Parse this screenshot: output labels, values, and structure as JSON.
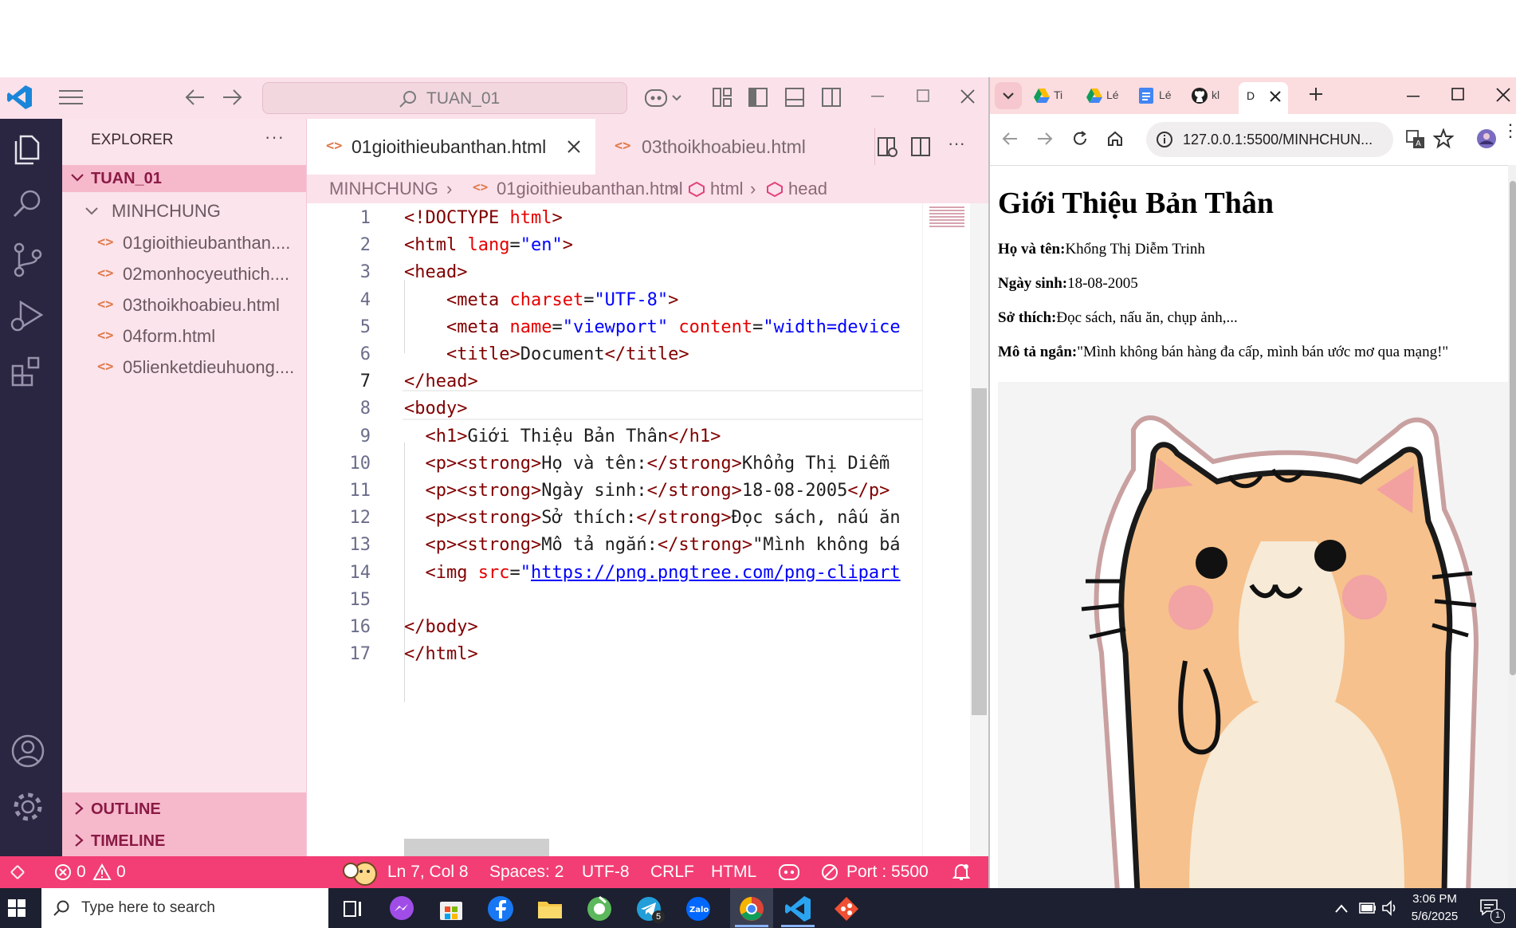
{
  "vscode": {
    "search_text": "TUAN_01",
    "explorer_title": "EXPLORER",
    "explorer_more": "···",
    "workspace": "TUAN_01",
    "folder": "MINHCHUNG",
    "files": [
      "01gioithieubanthan....",
      "02monhocyeuthich....",
      "03thoikhoabieu.html",
      "04form.html",
      "05lienketdieuhuong...."
    ],
    "outline": "OUTLINE",
    "timeline": "TIMELINE",
    "tabs": [
      {
        "label": "01gioithieubanthan.html",
        "active": true
      },
      {
        "label": "03thoikhoabieu.html",
        "active": false
      }
    ],
    "breadcrumb": [
      "MINHCHUNG",
      "01gioithieubanthan.html",
      "html",
      "head"
    ],
    "code_lines": [
      {
        "n": "1",
        "parts": [
          [
            "tg",
            "<!DOCTYPE "
          ],
          [
            "at",
            "html"
          ],
          [
            "tg",
            ">"
          ]
        ]
      },
      {
        "n": "2",
        "parts": [
          [
            "tg",
            "<html "
          ],
          [
            "at",
            "lang"
          ],
          [
            "tx",
            "="
          ],
          [
            "vl",
            "\"en\""
          ],
          [
            "tg",
            ">"
          ]
        ]
      },
      {
        "n": "3",
        "parts": [
          [
            "tg",
            "<head>"
          ]
        ]
      },
      {
        "n": "4",
        "parts": [
          [
            "tx",
            "    "
          ],
          [
            "tg",
            "<meta "
          ],
          [
            "at",
            "charset"
          ],
          [
            "tx",
            "="
          ],
          [
            "vl",
            "\"UTF-8\""
          ],
          [
            "tg",
            ">"
          ]
        ]
      },
      {
        "n": "5",
        "parts": [
          [
            "tx",
            "    "
          ],
          [
            "tg",
            "<meta "
          ],
          [
            "at",
            "name"
          ],
          [
            "tx",
            "="
          ],
          [
            "vl",
            "\"viewport\""
          ],
          [
            "tx",
            " "
          ],
          [
            "at",
            "content"
          ],
          [
            "tx",
            "="
          ],
          [
            "vl",
            "\"width=device"
          ]
        ]
      },
      {
        "n": "6",
        "parts": [
          [
            "tx",
            "    "
          ],
          [
            "tg",
            "<title>"
          ],
          [
            "tx",
            "Document"
          ],
          [
            "tg",
            "</title>"
          ]
        ]
      },
      {
        "n": "7",
        "parts": [
          [
            "tg",
            "</head>"
          ]
        ]
      },
      {
        "n": "8",
        "parts": [
          [
            "tg",
            "<body>"
          ]
        ]
      },
      {
        "n": "9",
        "parts": [
          [
            "tx",
            "  "
          ],
          [
            "tg",
            "<h1>"
          ],
          [
            "tx",
            "Giới Thiệu Bản Thân"
          ],
          [
            "tg",
            "</h1>"
          ]
        ]
      },
      {
        "n": "10",
        "parts": [
          [
            "tx",
            "  "
          ],
          [
            "tg",
            "<p><strong>"
          ],
          [
            "tx",
            "Họ và tên:"
          ],
          [
            "tg",
            "</strong>"
          ],
          [
            "tx",
            "Khổng Thị Diễm"
          ]
        ]
      },
      {
        "n": "11",
        "parts": [
          [
            "tx",
            "  "
          ],
          [
            "tg",
            "<p><strong>"
          ],
          [
            "tx",
            "Ngày sinh:"
          ],
          [
            "tg",
            "</strong>"
          ],
          [
            "tx",
            "18-08-2005"
          ],
          [
            "tg",
            "</p>"
          ]
        ]
      },
      {
        "n": "12",
        "parts": [
          [
            "tx",
            "  "
          ],
          [
            "tg",
            "<p><strong>"
          ],
          [
            "tx",
            "Sở thích:"
          ],
          [
            "tg",
            "</strong>"
          ],
          [
            "tx",
            "Đọc sách, nấu ăn"
          ]
        ]
      },
      {
        "n": "13",
        "parts": [
          [
            "tx",
            "  "
          ],
          [
            "tg",
            "<p><strong>"
          ],
          [
            "tx",
            "Mô tả ngắn:"
          ],
          [
            "tg",
            "</strong>"
          ],
          [
            "tx",
            "\"Mình không bá"
          ]
        ]
      },
      {
        "n": "14",
        "parts": [
          [
            "tx",
            "  "
          ],
          [
            "tg",
            "<img "
          ],
          [
            "at",
            "src"
          ],
          [
            "tx",
            "="
          ],
          [
            "vl",
            "\""
          ],
          [
            "lnk",
            "https://png.pngtree.com/png-clipart"
          ]
        ]
      },
      {
        "n": "15",
        "parts": []
      },
      {
        "n": "16",
        "parts": [
          [
            "tg",
            "</body>"
          ]
        ]
      },
      {
        "n": "17",
        "parts": [
          [
            "tg",
            "</html>"
          ]
        ]
      }
    ],
    "active_line": "7",
    "status": {
      "errors": "0",
      "warnings": "0",
      "position": "Ln 7, Col 8",
      "spaces": "Spaces: 2",
      "encoding": "UTF-8",
      "eol": "CRLF",
      "language": "HTML",
      "port": "Port : 5500"
    }
  },
  "chrome": {
    "tabs": [
      "Ti",
      "Lé",
      "Lé",
      "kl",
      "D"
    ],
    "url": "127.0.0.1:5500/MINHCHUN...",
    "page": {
      "heading": "Giới Thiệu Bản Thân",
      "rows": [
        {
          "label": "Họ và tên:",
          "value": "Khổng Thị Diễm Trinh"
        },
        {
          "label": "Ngày sinh:",
          "value": "18-08-2005"
        },
        {
          "label": "Sở thích:",
          "value": "Đọc sách, nấu ăn, chụp ảnh,..."
        },
        {
          "label": "Mô tả ngắn:",
          "value": "\"Mình không bán hàng đa cấp, mình bán ước mơ qua mạng!\""
        }
      ]
    }
  },
  "taskbar": {
    "search_placeholder": "Type here to search",
    "telegram_badge": "5",
    "time": "3:06 PM",
    "date": "5/6/2025",
    "notif_count": "1"
  },
  "colors": {
    "status_bar": "#f23e74",
    "sidebar": "#fbe4ec",
    "title_bar": "#fbe1ea",
    "activity_bar": "#2a2540",
    "chrome_tabbar": "#fbdcdf"
  }
}
